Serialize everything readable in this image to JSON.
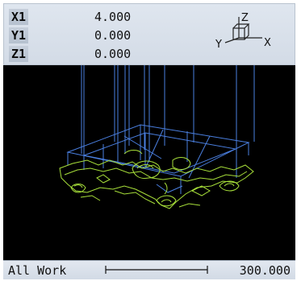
{
  "coordinates": [
    {
      "axis": "X1",
      "value": "4.000"
    },
    {
      "axis": "Y1",
      "value": "0.000"
    },
    {
      "axis": "Z1",
      "value": "0.000"
    }
  ],
  "triad": {
    "x_label": "X",
    "y_label": "Y",
    "z_label": "Z"
  },
  "status": {
    "view_label": "All Work",
    "scale_value": "300.000"
  },
  "colors": {
    "toolpath": "#4a7fe0",
    "contour": "#a8e03a",
    "background": "#000000"
  }
}
